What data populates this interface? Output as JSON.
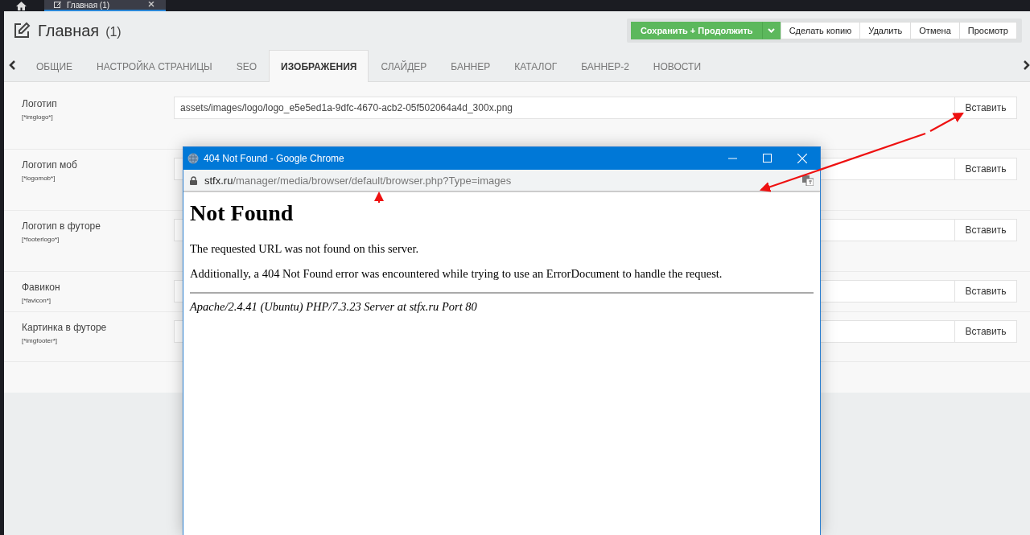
{
  "app_tabs": [
    {
      "label": "Главная (1)",
      "selected": true
    }
  ],
  "page": {
    "title": "Главная",
    "count": "(1)"
  },
  "actions": [
    {
      "label": "Сохранить + Продолжить",
      "kind": "primary"
    },
    {
      "label": "Сделать копию",
      "kind": "plain"
    },
    {
      "label": "Удалить",
      "kind": "plain"
    },
    {
      "label": "Отмена",
      "kind": "plain"
    },
    {
      "label": "Просмотр",
      "kind": "plain"
    }
  ],
  "tabs": [
    {
      "label": "ОБЩИЕ",
      "selected": false
    },
    {
      "label": "НАСТРОЙКА СТРАНИЦЫ",
      "selected": false
    },
    {
      "label": "SEO",
      "selected": false
    },
    {
      "label": "ИЗОБРАЖЕНИЯ",
      "selected": true
    },
    {
      "label": "СЛАЙДЕР",
      "selected": false
    },
    {
      "label": "БАННЕР",
      "selected": false
    },
    {
      "label": "КАТАЛОГ",
      "selected": false
    },
    {
      "label": "БАННЕР-2",
      "selected": false
    },
    {
      "label": "НОВОСТИ",
      "selected": false
    }
  ],
  "fields": [
    {
      "label": "Логотип",
      "tag": "[*imglogo*]",
      "value": "assets/images/logo/logo_e5e5ed1a-9dfc-4670-acb2-05f502064a4d_300x.png",
      "button": "Вставить"
    },
    {
      "label": "Логотип моб",
      "tag": "[*logomob*]",
      "button": "Вставить"
    },
    {
      "label": "Логотип в футоре",
      "tag": "[*footerlogo*]",
      "button": "Вставить"
    },
    {
      "label": "Фавикон",
      "tag": "[*favicon*]",
      "button": "Вставить"
    },
    {
      "label": "Картинка в футоре",
      "tag": "[*imgfooter*]",
      "button": "Вставить"
    }
  ],
  "popup": {
    "title": "404 Not Found - Google Chrome",
    "url_host": "stfx.ru",
    "url_path": "/manager/media/browser/default/browser.php?Type=images",
    "heading": "Not Found",
    "paragraphs": [
      "The requested URL was not found on this server.",
      "Additionally, a 404 Not Found error was encountered while trying to use an ErrorDocument to handle the request."
    ],
    "footer": "Apache/2.4.41 (Ubuntu) PHP/7.3.23 Server at stfx.ru Port 80"
  }
}
